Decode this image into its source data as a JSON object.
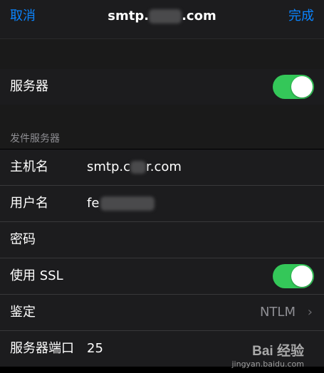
{
  "nav": {
    "cancel": "取消",
    "title_prefix": "smtp.",
    "title_suffix": ".com",
    "done": "完成"
  },
  "server_toggle": {
    "label": "服务器",
    "on": true
  },
  "outgoing": {
    "header": "发件服务器",
    "host_label": "主机名",
    "host_prefix": "smtp.c",
    "host_suffix": "r.com",
    "user_label": "用户名",
    "user_prefix": "fe",
    "password_label": "密码",
    "ssl_label": "使用 SSL",
    "ssl_on": true,
    "auth_label": "鉴定",
    "auth_value": "NTLM",
    "port_label": "服务器端口",
    "port_value": "25"
  },
  "watermark": {
    "logo": "Bai  经验",
    "url": "jingyan.baidu.com"
  },
  "colors": {
    "accent": "#0a84ff",
    "toggle_on": "#34c759",
    "bg": "#000000",
    "cell": "#1c1c1e"
  }
}
